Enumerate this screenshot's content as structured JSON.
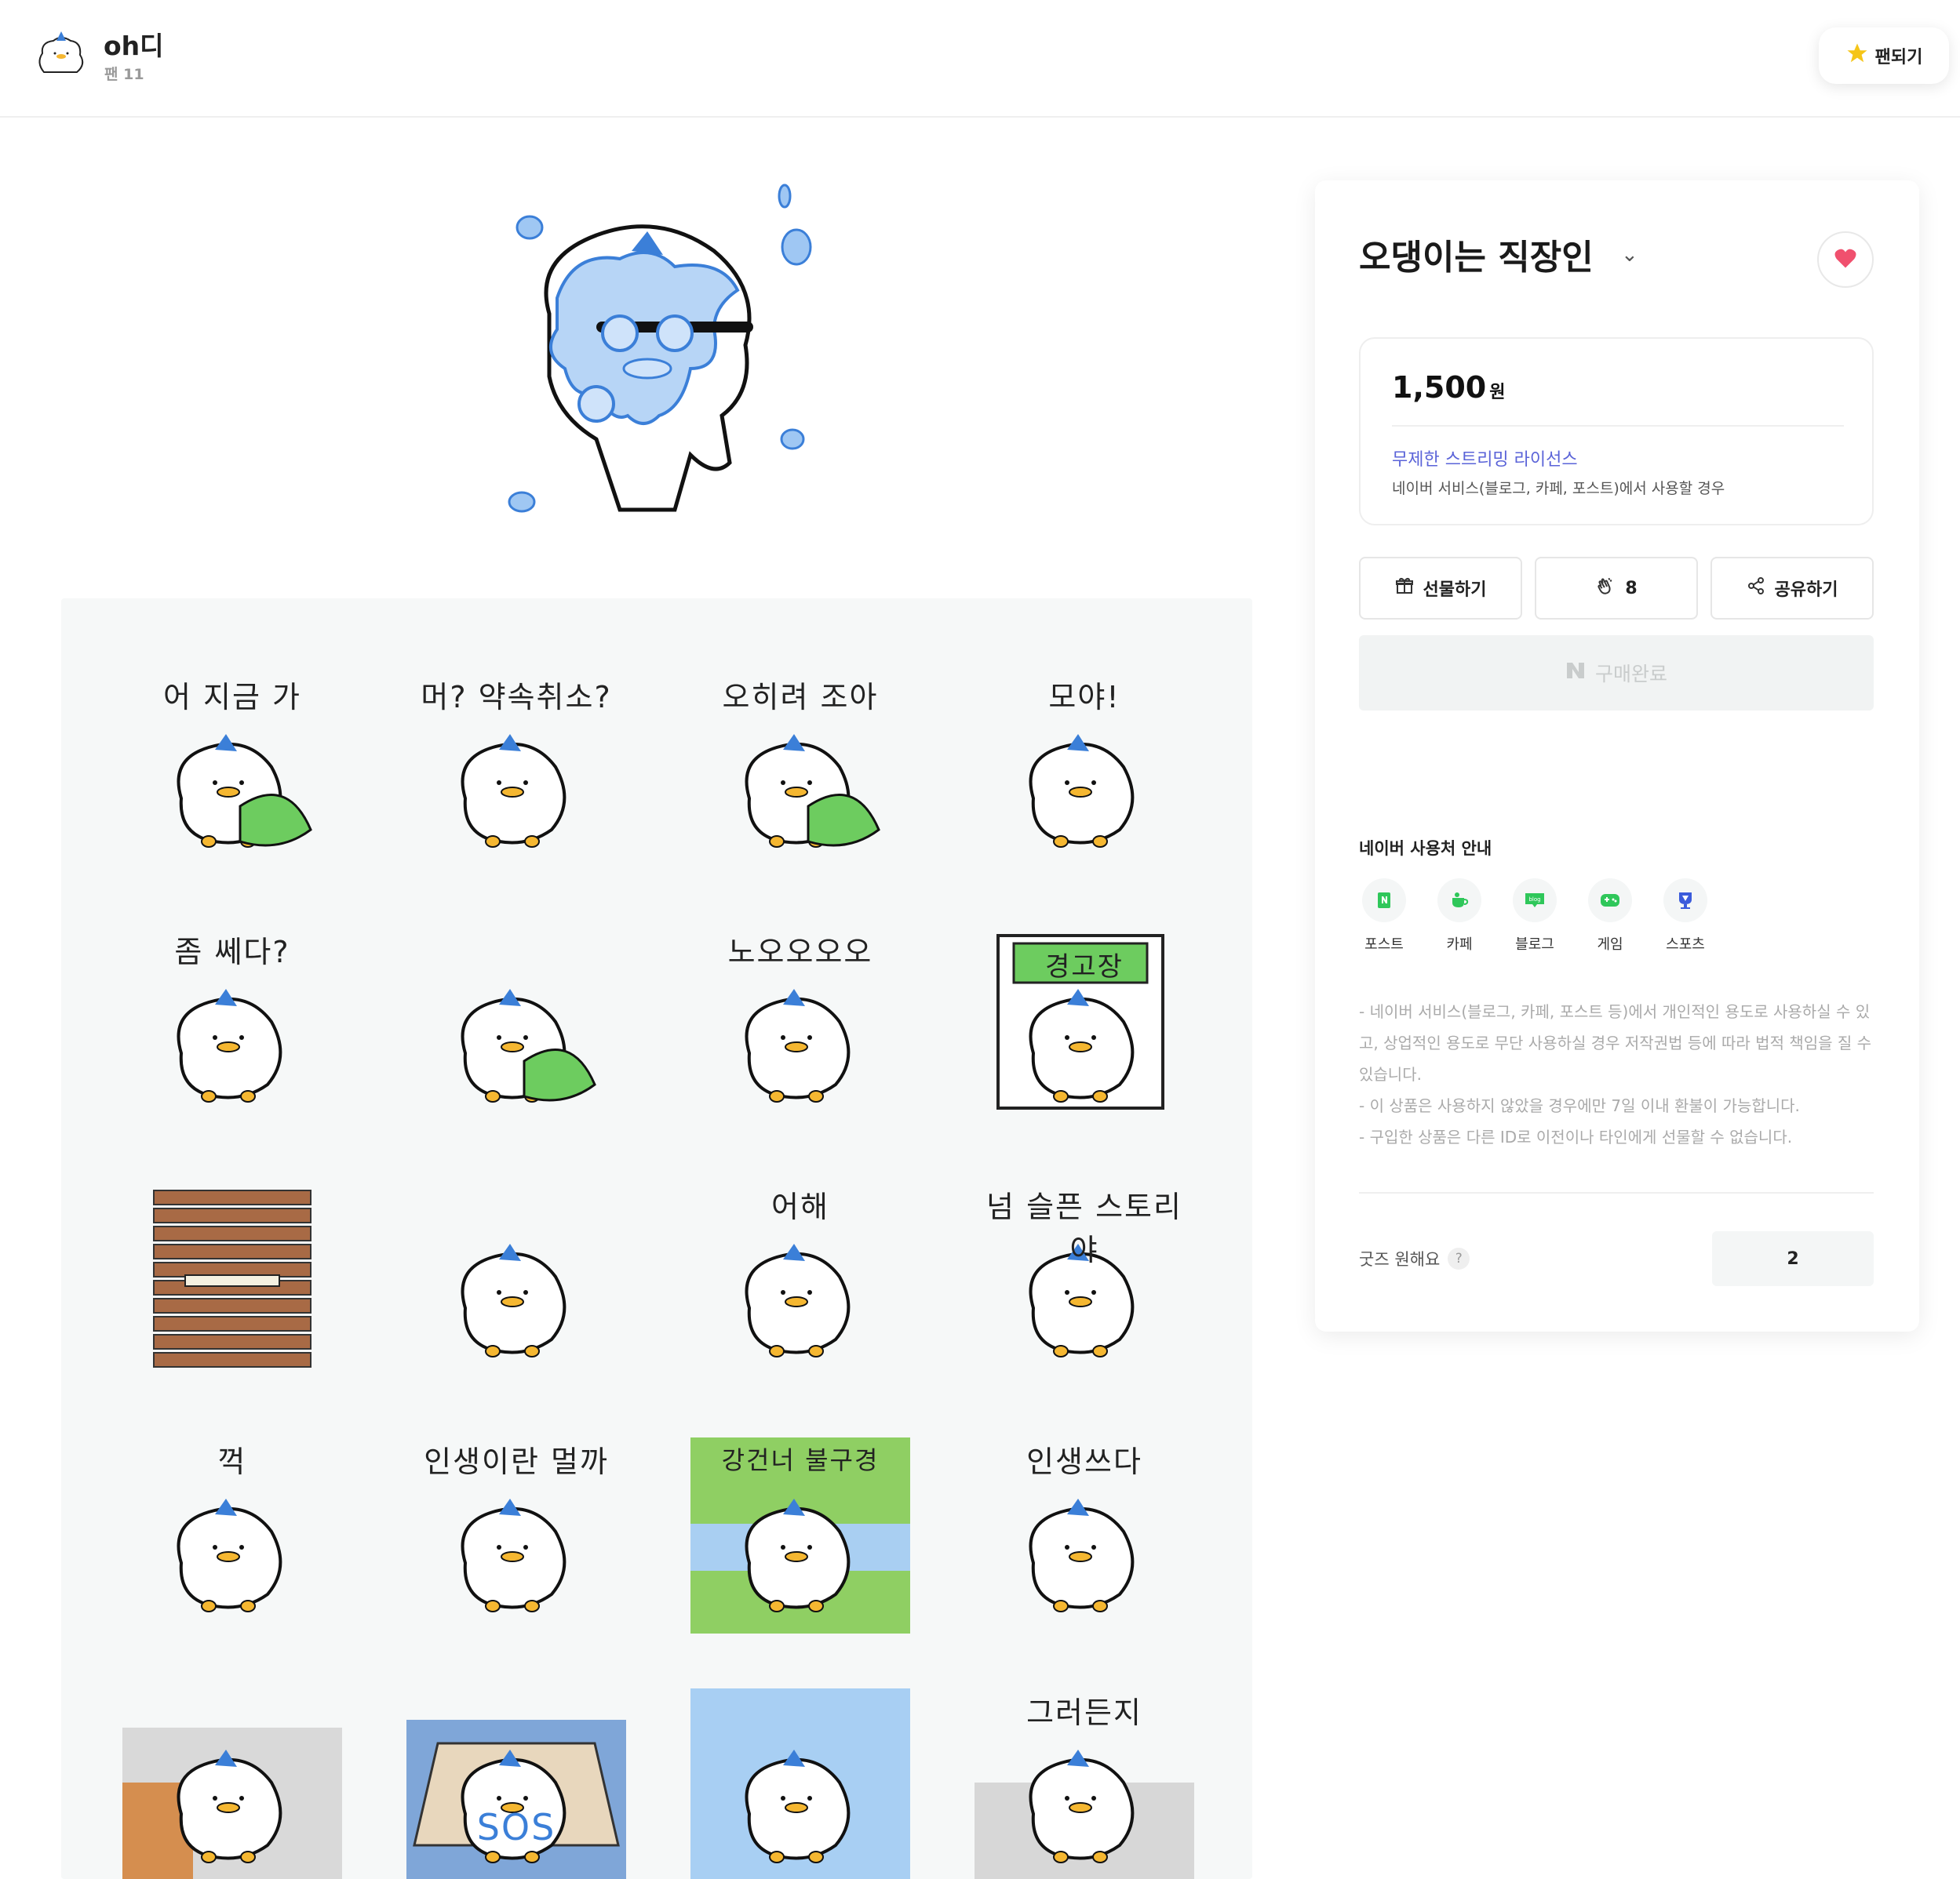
{
  "header": {
    "creator_name": "oh디",
    "fan_count": "팬 11",
    "fan_button_label": "팬되기"
  },
  "product": {
    "title": "오댕이는 직장인",
    "price": "1,500",
    "price_unit": "원",
    "license_title": "무제한 스트리밍 라이선스",
    "license_desc": "네이버 서비스(블로그, 카페, 포스트)에서 사용할 경우",
    "gift_label": "선물하기",
    "cheer_count": "8",
    "share_label": "공유하기",
    "buy_label": "구매완료"
  },
  "usage": {
    "title": "네이버 사용처 안내",
    "items": [
      {
        "label": "포스트",
        "icon": "post-icon"
      },
      {
        "label": "카페",
        "icon": "cafe-icon"
      },
      {
        "label": "블로그",
        "icon": "blog-icon"
      },
      {
        "label": "게임",
        "icon": "game-icon"
      },
      {
        "label": "스포츠",
        "icon": "sports-icon"
      }
    ],
    "notice": [
      "- 네이버 서비스(블로그, 카페, 포스트 등)에서 개인적인 용도로 사용하실 수 있고, 상업적인 용도로 무단 사용하실 경우 저작권법 등에 따라 법적 책임을 질 수 있습니다.",
      "- 이 상품은 사용하지 않았을 경우에만 7일 이내 환불이 가능합니다.",
      "- 구입한 상품은 다른 ID로 이전이나 타인에게 선물할 수 없습니다."
    ]
  },
  "goods": {
    "label": "굿즈 원해요",
    "help": "?",
    "count": "2"
  },
  "colors": {
    "accent_blue": "#5a63d8",
    "like_pink": "#f0506e",
    "star_yellow": "#f5c518",
    "naver_green": "#2fc75a"
  },
  "stickers": [
    {
      "caption": "어 지금 가"
    },
    {
      "caption": "머? 약속취소?"
    },
    {
      "caption": "오히려 조아"
    },
    {
      "caption": "모야!"
    },
    {
      "caption": "좀 쎄다?"
    },
    {
      "caption": ""
    },
    {
      "caption": "노오오오오"
    },
    {
      "caption": "경고장"
    },
    {
      "caption": ""
    },
    {
      "caption": ""
    },
    {
      "caption": "어해"
    },
    {
      "caption": "넘 슬픈 스토리야"
    },
    {
      "caption": "꺽"
    },
    {
      "caption": "인생이란 멀까"
    },
    {
      "caption": "강건너 불구경"
    },
    {
      "caption": "인생쓰다"
    },
    {
      "caption": ""
    },
    {
      "caption": "SOS"
    },
    {
      "caption": ""
    },
    {
      "caption": "그러든지"
    }
  ]
}
